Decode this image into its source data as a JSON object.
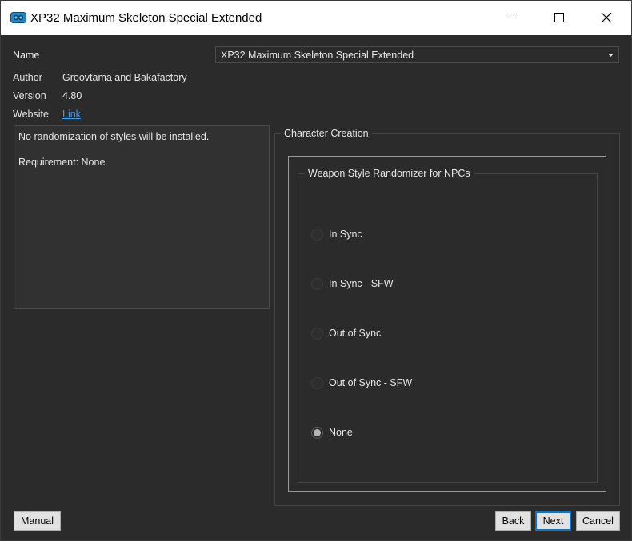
{
  "window": {
    "title": "XP32 Maximum Skeleton Special Extended"
  },
  "info": {
    "name_label": "Name",
    "name_value": "XP32 Maximum Skeleton Special Extended",
    "author_label": "Author",
    "author_value": "Groovtama and Bakafactory",
    "version_label": "Version",
    "version_value": "4.80",
    "website_label": "Website",
    "website_link": "Link"
  },
  "description": {
    "line1": "No randomization of styles will be installed.",
    "line2": "Requirement: None"
  },
  "group": {
    "title": "Character Creation",
    "sub_title": "Weapon Style Randomizer for NPCs",
    "options": [
      {
        "label": "In Sync",
        "checked": false
      },
      {
        "label": "In Sync - SFW",
        "checked": false
      },
      {
        "label": "Out of Sync",
        "checked": false
      },
      {
        "label": "Out of Sync - SFW",
        "checked": false
      },
      {
        "label": "None",
        "checked": true
      }
    ]
  },
  "buttons": {
    "manual": "Manual",
    "back": "Back",
    "next": "Next",
    "cancel": "Cancel"
  },
  "colors": {
    "background": "#2b2b2b",
    "link": "#3b9cf0",
    "focus": "#0078d7"
  }
}
